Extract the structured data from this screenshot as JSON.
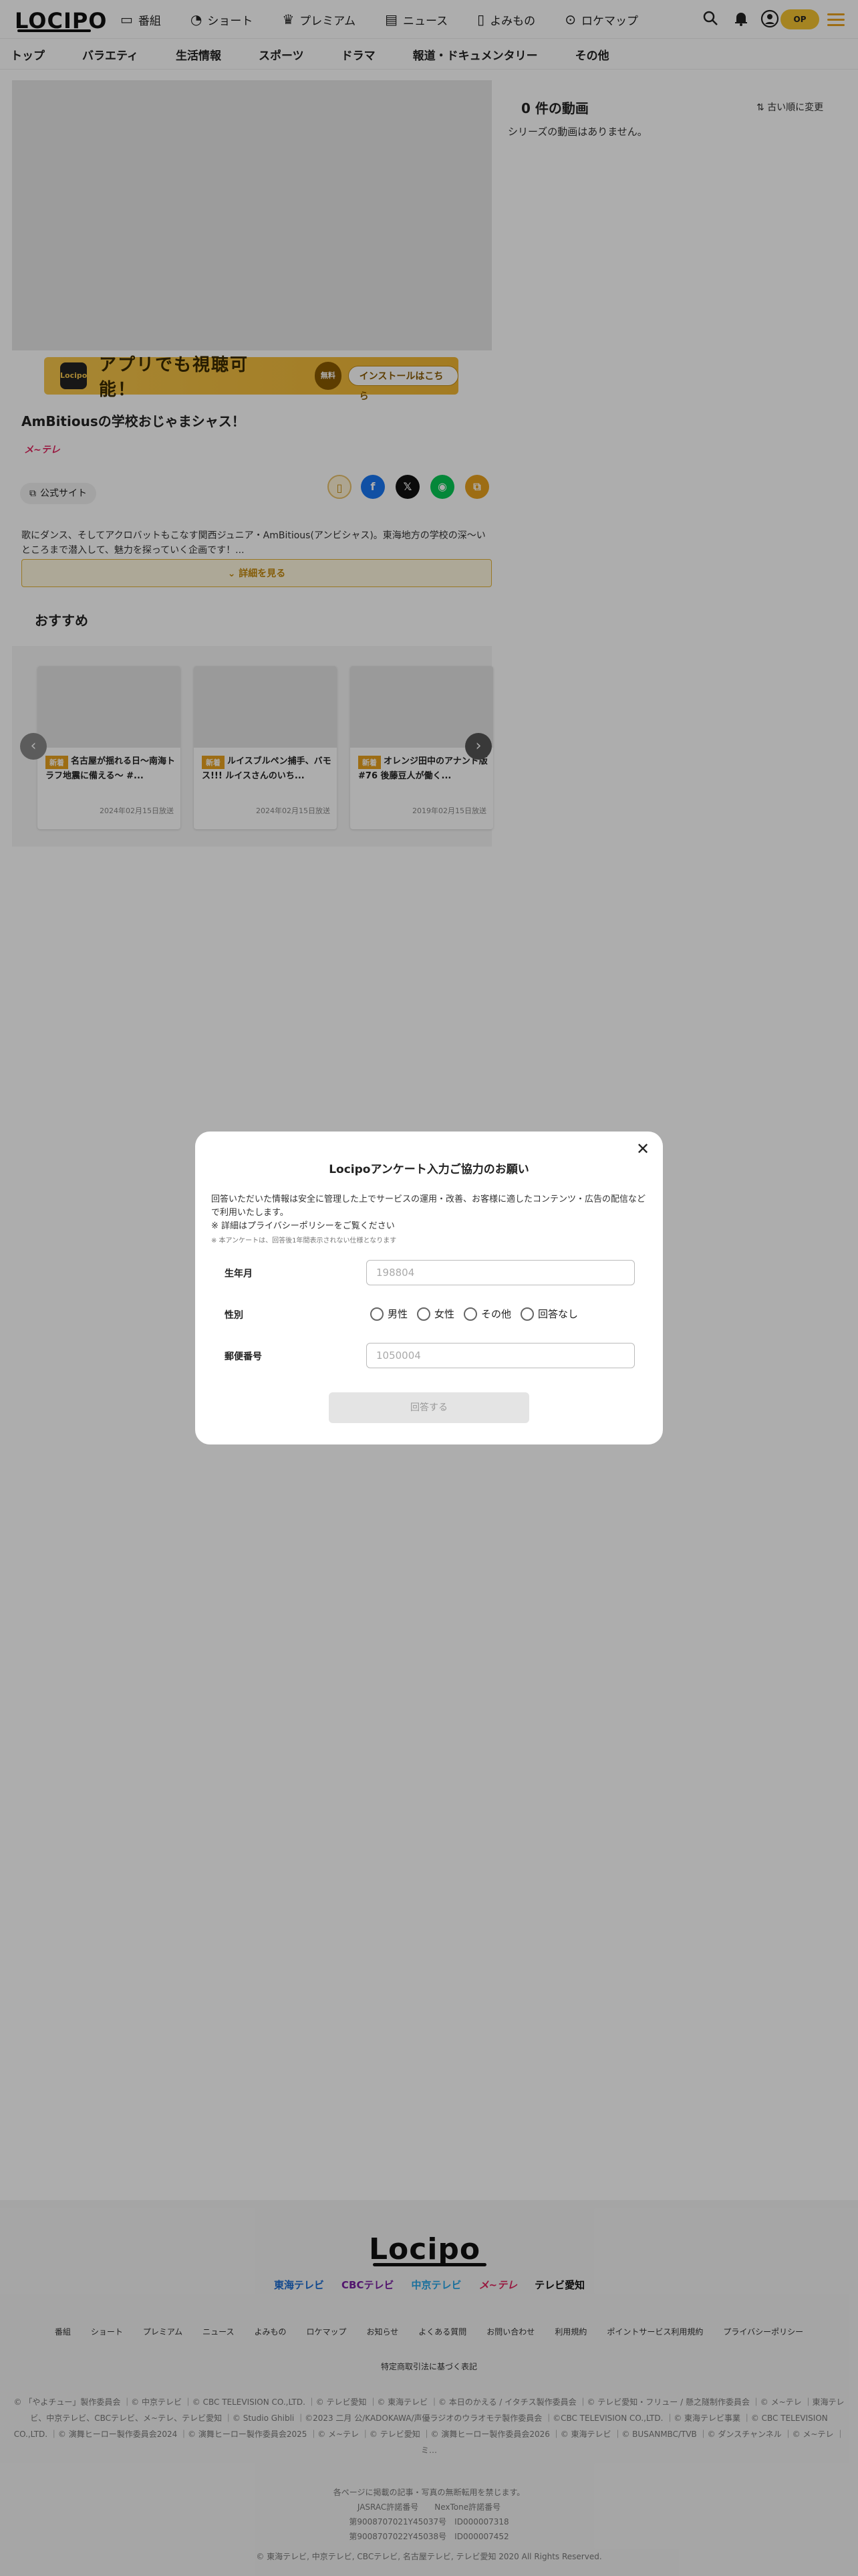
{
  "header": {
    "logo": "LOCIPO",
    "nav": [
      {
        "icon": "tv-icon",
        "glyph": "▭",
        "label": "番組"
      },
      {
        "icon": "short-icon",
        "glyph": "◔",
        "label": "ショート"
      },
      {
        "icon": "premium-icon",
        "glyph": "♛",
        "label": "プレミアム"
      },
      {
        "icon": "news-icon",
        "glyph": "▤",
        "label": "ニュース"
      },
      {
        "icon": "book-icon",
        "glyph": "▯",
        "label": "よみもの"
      },
      {
        "icon": "map-pin-icon",
        "glyph": "⊙",
        "label": "ロケマップ"
      }
    ],
    "login_label": "OP"
  },
  "subnav": [
    "トップ",
    "バラエティ",
    "生活情報",
    "スポーツ",
    "ドラマ",
    "報道・ドキュメンタリー",
    "その他"
  ],
  "banner": {
    "app_label": "Locipo",
    "text": "アプリでも視聴可能！",
    "free": "無料",
    "install": "インストールはこちら"
  },
  "program": {
    "title": "AmBitiousの学校おじゃまシャス！",
    "station": "メ~テレ",
    "site_button": "公式サイト",
    "description": "歌にダンス、そしてアクロバットもこなす関西ジュニア・AmBitious(アンビシャス)。東海地方の学校の深〜いところまで潜入して、魅力を探っていく企画です！...",
    "more_button": "詳細を見る"
  },
  "recommend": {
    "heading": "おすすめ",
    "cards": [
      {
        "tag": "新着",
        "title": "名古屋が揺れる日〜南海トラフ地震に備える〜 #...",
        "date": "2024年02月15日放送"
      },
      {
        "tag": "新着",
        "title": "ルイスブルペン捕手、バモス!!! ルイスさんのいち...",
        "date": "2024年02月15日放送"
      },
      {
        "tag": "新着",
        "title": "オレンジ田中のアナンド版 #76 後藤豆人が働く...",
        "date": "2019年02月15日放送"
      }
    ]
  },
  "episodes": {
    "count": "0 件の動画",
    "sort": "古い順に変更",
    "empty": "シリーズの動画はありません。"
  },
  "footer": {
    "logo": "Locipo",
    "stations": [
      "東海テレビ",
      "CBCテレビ",
      "中京テレビ",
      "メ~テレ",
      "テレビ愛知"
    ],
    "links": [
      "番組",
      "ショート",
      "プレミアム",
      "ニュース",
      "よみもの",
      "ロケマップ",
      "お知らせ",
      "よくある質問",
      "お問い合わせ",
      "利用規約",
      "ポイントサービス利用規約",
      "プライバシーポリシー"
    ],
    "privacy": "特定商取引法に基づく表記",
    "copyright": "© 「やよチュー」製作委員会 ｜© 中京テレビ ｜© CBC TELEVISION CO.,LTD. ｜© テレビ愛知 ｜© 東海テレビ ｜© 本日のかえる / イタチス製作委員会 ｜© テレビ愛知・フリュー / 懸之隧制作委員会 ｜© メ~テレ ｜東海テレビ、中京テレビ、CBCテレビ、メ~テレ、テレビ愛知 ｜© Studio Ghibli ｜©2023 二月 公/KADOKAWA/声優ラジオのウラオモテ製作委員会 ｜©CBC TELEVISION CO.,LTD. ｜© 東海テレビ事業 ｜© CBC TELEVISION CO.,LTD. ｜© 演舞ヒーロー製作委員会2024 ｜© 演舞ヒーロー製作委員会2025 ｜© メ~テレ ｜© テレビ愛知 ｜© 演舞ヒーロー製作委員会2026 ｜© 東海テレビ ｜© BUSANMBC/TVB ｜© ダンスチャンネル ｜© メ~テレ ｜ミ…",
    "license1": "各ページに掲載の記事・写真の無断転用を禁じます。",
    "license2": "JASRAC許諾番号　　NexTone許諾番号",
    "license3": "第9008707021Y45037号　ID000007318",
    "license4": "第9008707022Y45038号　ID000007452",
    "rights": "© 東海テレビ, 中京テレビ, CBCテレビ, 名古屋テレビ, テレビ愛知 2020 All Rights Reserved."
  },
  "modal": {
    "title": "Locipoアンケート入力ご協力のお願い",
    "intro": "回答いただいた情報は安全に管理した上でサービスの運用・改善、お客様に適したコンテンツ・広告の配信などで利用いたします。",
    "privacy_note": "※ 詳細はプライバシーポリシーをご覧ください",
    "small_note": "※ 本アンケートは、回答後1年間表示されない仕様となります",
    "birth_label": "生年月",
    "birth_placeholder": "198804",
    "gender_label": "性別",
    "gender_options": [
      "男性",
      "女性",
      "その他",
      "回答なし"
    ],
    "zip_label": "郵便番号",
    "zip_placeholder": "1050004",
    "submit": "回答する"
  },
  "colors": {
    "accent": "#e8a11e",
    "overlay": "rgba(0,0,0,0.32)"
  }
}
